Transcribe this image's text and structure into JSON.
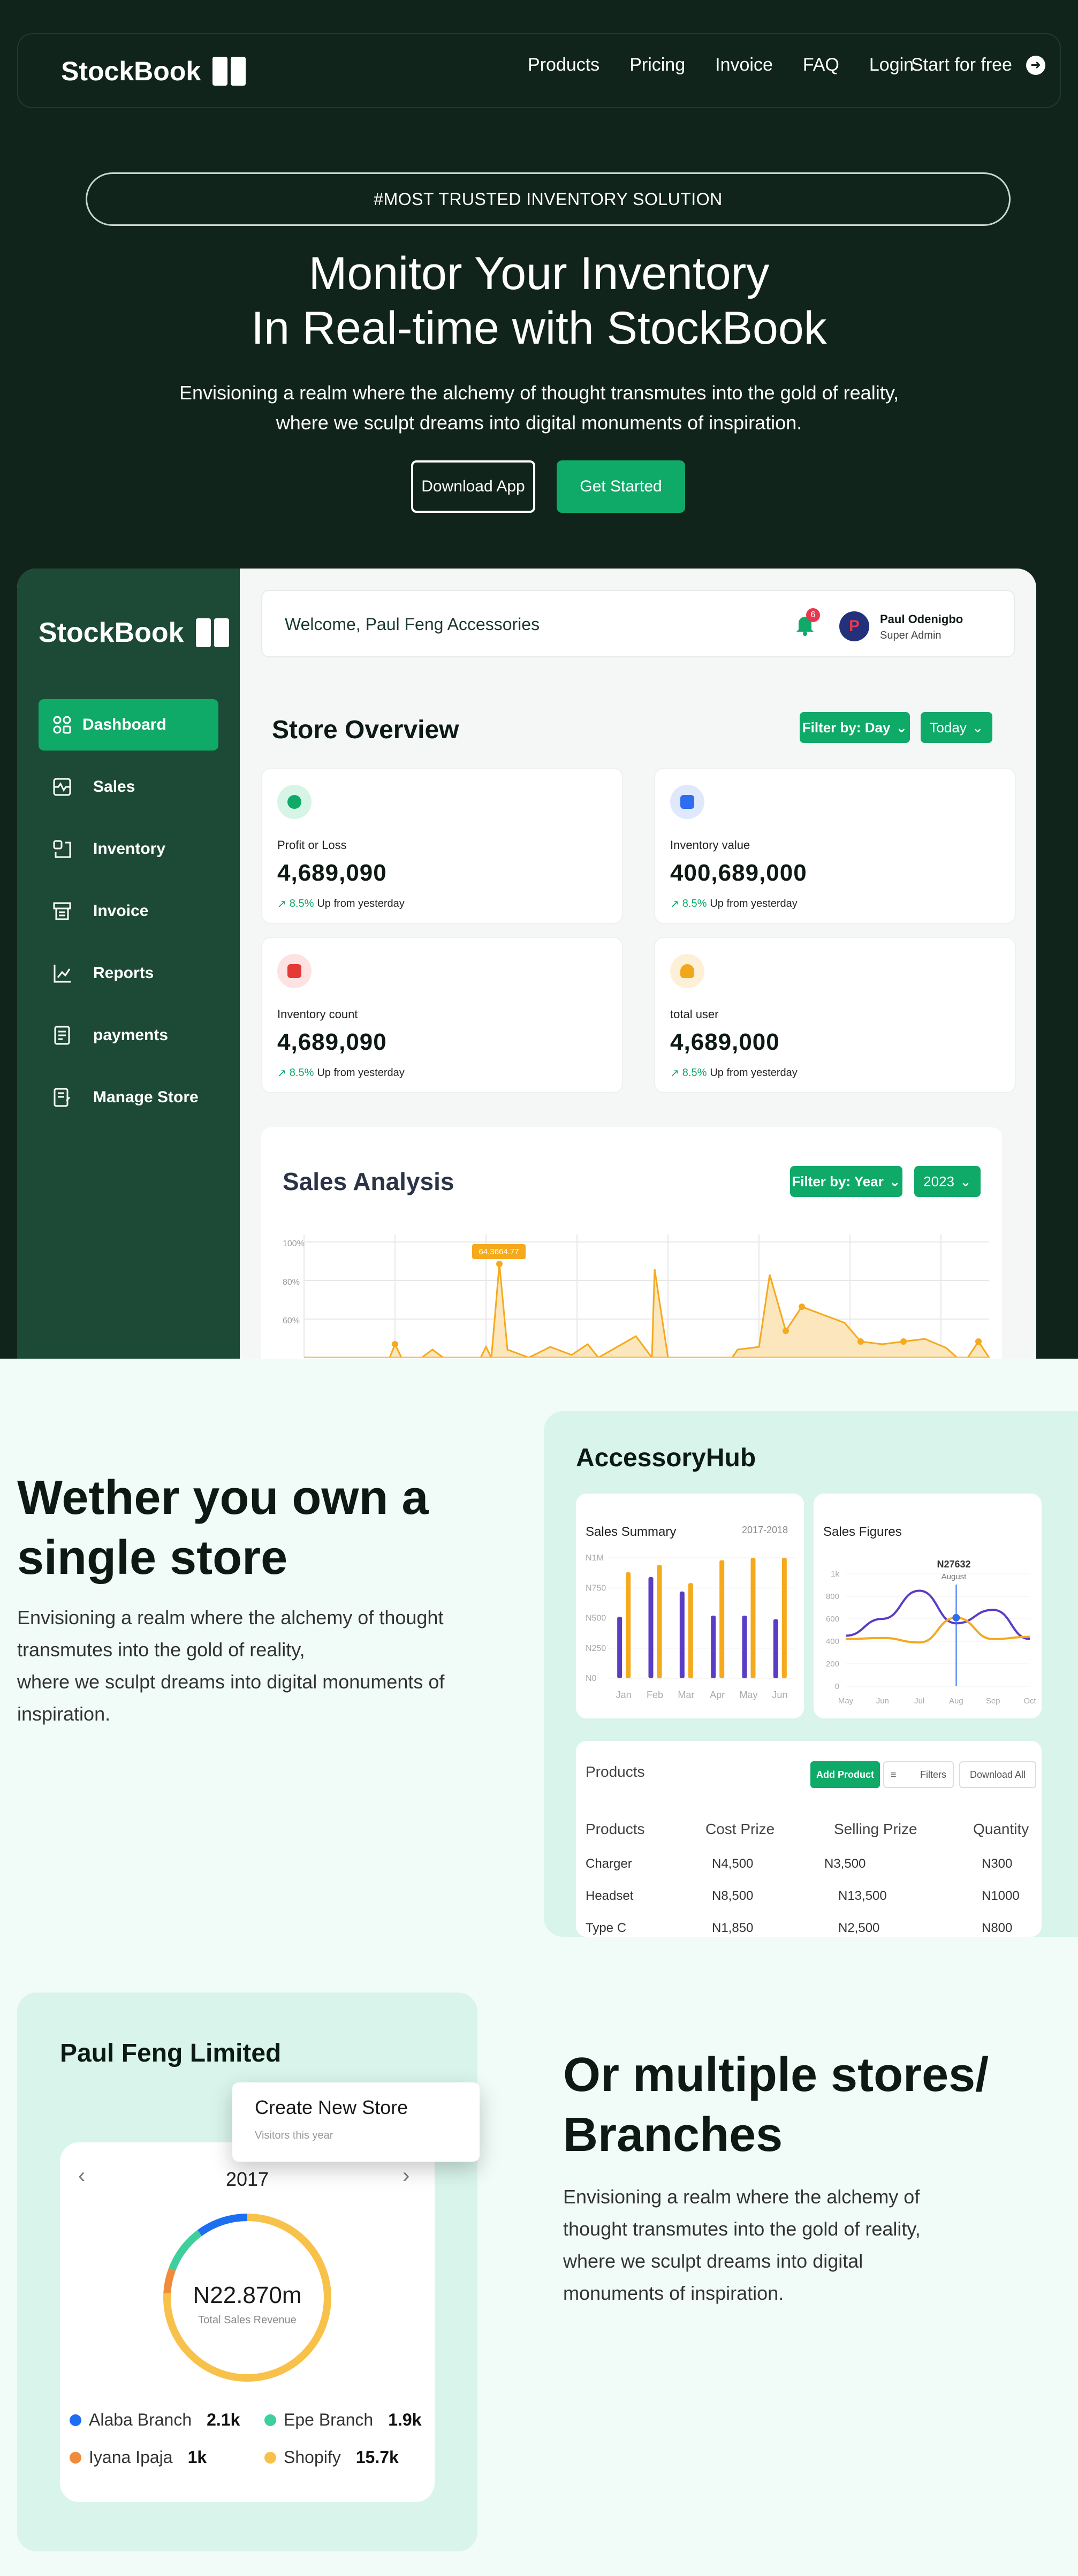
{
  "nav": {
    "brand": "StockBook",
    "links": [
      "Products",
      "Pricing",
      "Invoice",
      "FAQ",
      "Login"
    ],
    "cta": "Start for free"
  },
  "hero": {
    "tag": "#MOST TRUSTED INVENTORY SOLUTION",
    "title_line1": "Monitor Your Inventory",
    "title_line2": "In Real-time with StockBook",
    "sub_line1": "Envisioning a realm where the alchemy of thought transmutes into the gold of reality,",
    "sub_line2": "where we sculpt dreams into digital monuments of inspiration.",
    "btn_download": "Download App",
    "btn_start": "Get Started"
  },
  "dashboard": {
    "brand": "StockBook",
    "menu": [
      "Dashboard",
      "Sales",
      "Inventory",
      "Invoice",
      "Reports",
      "payments",
      "Manage Store"
    ],
    "welcome": "Welcome, Paul Feng Accessories",
    "notif_count": "6",
    "avatar_letter": "P",
    "user_name": "Paul Odenigbo",
    "user_role": "Super Admin",
    "overview_title": "Store Overview",
    "filter_day": "Filter by: Day",
    "filter_today": "Today",
    "cards": [
      {
        "label": "Profit or Loss",
        "value": "4,689,090",
        "change": "8.5%",
        "change_text": "Up from yesterday",
        "color": "#0fa968"
      },
      {
        "label": "Inventory value",
        "value": "400,689,000",
        "change": "8.5%",
        "change_text": "Up from yesterday",
        "color": "#2f6df0"
      },
      {
        "label": "Inventory count",
        "value": "4,689,090",
        "change": "8.5%",
        "change_text": "Up from yesterday",
        "color": "#e53935"
      },
      {
        "label": "total user",
        "value": "4,689,000",
        "change": "8.5%",
        "change_text": "Up from yesterday",
        "color": "#f2a71b"
      }
    ],
    "sales_title": "Sales Analysis",
    "filter_year": "Filter by: Year",
    "year": "2023",
    "yticks": [
      "100%",
      "80%",
      "60%"
    ],
    "peak_label": "64,3664.77"
  },
  "single": {
    "title_line1": "Wether you own a",
    "title_line2": "single store",
    "p_line1": "Envisioning a realm where the alchemy of thought",
    "p_line2": "transmutes into the gold of reality,",
    "p_line3": "where we sculpt dreams into digital monuments of",
    "p_line4": "inspiration."
  },
  "hub": {
    "title": "AccessoryHub",
    "summary_title": "Sales Summary",
    "summary_range": "2017-2018",
    "summary_yticks": [
      "N1M",
      "N750",
      "N500",
      "N250",
      "N0"
    ],
    "summary_months": [
      "Jan",
      "Feb",
      "Mar",
      "Apr",
      "May",
      "Jun"
    ],
    "figures_title": "Sales Figures",
    "figures_yticks": [
      "1k",
      "800",
      "600",
      "400",
      "200",
      "0"
    ],
    "figures_months": [
      "May",
      "Jun",
      "Jul",
      "Aug",
      "Sep",
      "Oct"
    ],
    "figures_tip_value": "N27632",
    "figures_tip_month": "August",
    "products_title": "Products",
    "add_product": "Add Product",
    "filters": "Filters",
    "download_all": "Download All",
    "columns": [
      "Products",
      "Cost Prize",
      "Selling Prize",
      "Quantity"
    ],
    "rows": [
      [
        "Charger",
        "N4,500",
        "N3,500",
        "N300"
      ],
      [
        "Headset",
        "N8,500",
        "N13,500",
        "N1000"
      ],
      [
        "Type C",
        "N1,850",
        "N2,500",
        "N800"
      ]
    ],
    "colors": {
      "bar_a": "#5b3cc4",
      "bar_b": "#f5a91c"
    }
  },
  "chart_data": [
    {
      "type": "bar",
      "title": "Sales Summary",
      "categories": [
        "Jan",
        "Feb",
        "Mar",
        "Apr",
        "May",
        "Jun"
      ],
      "series": [
        {
          "values": [
            510,
            840,
            720,
            520,
            520,
            490
          ]
        },
        {
          "values": [
            880,
            940,
            790,
            980,
            1000,
            1000
          ]
        }
      ],
      "ylim": [
        0,
        1000
      ]
    },
    {
      "type": "line",
      "title": "Sales Figures",
      "categories": [
        "May",
        "Jun",
        "Jul",
        "Aug",
        "Sep",
        "Oct"
      ],
      "series": [
        {
          "values": [
            450,
            600,
            850,
            560,
            680,
            420
          ]
        },
        {
          "values": [
            420,
            430,
            390,
            610,
            420,
            440
          ]
        }
      ],
      "ylim": [
        0,
        1000
      ]
    },
    {
      "type": "pie",
      "title": "Total Sales Revenue",
      "categories": [
        "Alaba Branch",
        "Epe Branch",
        "Iyana Ipaja",
        "Shopify"
      ],
      "values": [
        2.1,
        1.9,
        1,
        15.7
      ]
    }
  ],
  "branches": {
    "company": "Paul Feng Limited",
    "popup_title": "Create New Store",
    "popup_sub": "Visitors this year",
    "year": "2017",
    "total": "N22.870m",
    "total_label": "Total Sales Revenue",
    "legend": [
      {
        "name": "Alaba Branch",
        "value": "2.1k",
        "color": "#1e6ef2"
      },
      {
        "name": "Epe Branch",
        "value": "1.9k",
        "color": "#3ecf9d"
      },
      {
        "name": "Iyana Ipaja",
        "value": "1k",
        "color": "#f08b3c"
      },
      {
        "name": "Shopify",
        "value": "15.7k",
        "color": "#f8c14a"
      }
    ]
  },
  "multiple": {
    "title_line1": "Or multiple stores/",
    "title_line2": "Branches",
    "p_line1": "Envisioning a realm where the alchemy of",
    "p_line2": "thought transmutes into the gold of reality,",
    "p_line3": "where we sculpt dreams into digital",
    "p_line4": "monuments of inspiration."
  }
}
